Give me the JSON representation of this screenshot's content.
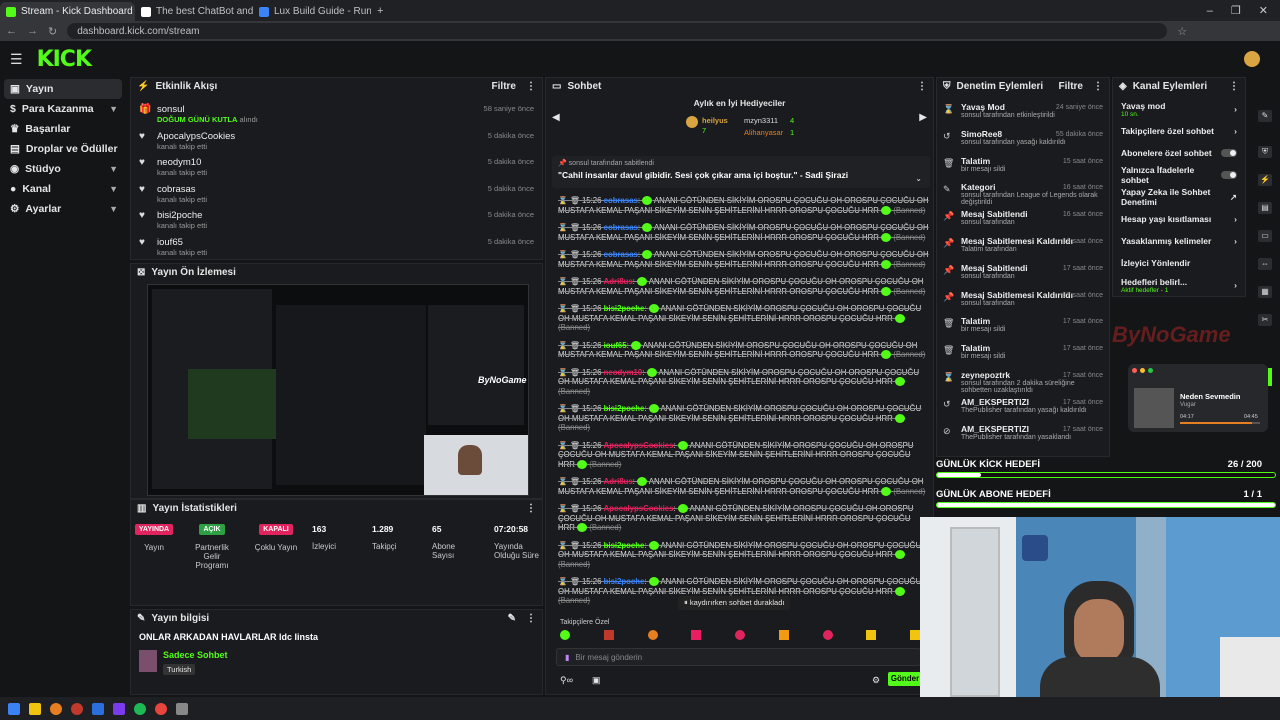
{
  "browser": {
    "tabs": [
      {
        "label": "Stream - Kick Dashboard",
        "color": "#53fc18"
      },
      {
        "label": "The best ChatBot and Widgets",
        "color": "#ffffff"
      },
      {
        "label": "Lux Build Guide - Runes, Items",
        "color": "#3b82f6"
      }
    ],
    "url": "dashboard.kick.com/stream"
  },
  "header": {
    "logo": "KICK"
  },
  "sidebar": {
    "items": [
      {
        "label": "Yayın",
        "icon": "video-icon",
        "active": true
      },
      {
        "label": "Para Kazanma",
        "icon": "money-icon",
        "chevron": true
      },
      {
        "label": "Başarılar",
        "icon": "trophy-icon"
      },
      {
        "label": "Droplar ve Ödüller",
        "icon": "gift-icon"
      },
      {
        "label": "Stüdyo",
        "icon": "studio-icon",
        "chevron": true
      },
      {
        "label": "Kanal",
        "icon": "user-icon",
        "chevron": true
      },
      {
        "label": "Ayarlar",
        "icon": "gear-icon",
        "chevron": true
      }
    ]
  },
  "activity": {
    "title": "Etkinlik Akışı",
    "filter": "Filtre",
    "items": [
      {
        "name": "sonsul",
        "sub": "DOĞUM GÜNÜ KUTLA",
        "sub2": "alındı",
        "time": "58 saniye önce",
        "icon": "gift-icon"
      },
      {
        "name": "ApocalypsCookies",
        "sub": "kanalı takip etti",
        "time": "5 dakika önce",
        "icon": "heart-icon"
      },
      {
        "name": "neodym10",
        "sub": "kanalı takip etti",
        "time": "5 dakika önce",
        "icon": "heart-icon"
      },
      {
        "name": "cobrasas",
        "sub": "kanalı takip etti",
        "time": "5 dakika önce",
        "icon": "heart-icon"
      },
      {
        "name": "bisi2poche",
        "sub": "kanalı takip etti",
        "time": "5 dakika önce",
        "icon": "heart-icon"
      },
      {
        "name": "iouf65",
        "sub": "kanalı takip etti",
        "time": "5 dakika önce",
        "icon": "heart-icon"
      }
    ]
  },
  "preview": {
    "title": "Yayın Ön İzlemesi",
    "watermark": "ByNoGame"
  },
  "stats": {
    "title": "Yayın İstatistikleri",
    "items": [
      {
        "badge": "YAYINDA",
        "badge_color": "#e0245e",
        "label": "Yayın"
      },
      {
        "badge": "AÇIK",
        "badge_color": "#2ea043",
        "label": "Partnerlik Gelir Programı"
      },
      {
        "badge": "KAPALI",
        "badge_color": "#e0245e",
        "label": "Çoklu Yayın"
      },
      {
        "value": "163",
        "label": "İzleyici"
      },
      {
        "value": "1.289",
        "label": "Takipçi"
      },
      {
        "value": "65",
        "label": "Abone Sayısı"
      },
      {
        "value": "07:20:58",
        "label": "Yayında Olduğu Süre"
      }
    ]
  },
  "stream_info": {
    "title": "Yayın bilgisi",
    "stream_title": "ONLAR ARKADAN HAVLARLAR ldc linsta",
    "category": "Sadece Sohbet",
    "language": "Turkish"
  },
  "chat": {
    "title": "Sohbet",
    "gifters_title": "Aylık en İyi Hediyeciler",
    "gifters": [
      {
        "name": "heilyus",
        "count": "7"
      },
      {
        "name": "mzyn3311",
        "count": "4"
      },
      {
        "name": "Alihanyasar",
        "count": "1"
      }
    ],
    "pinned_by": "sonsul tarafından sabitlendi",
    "pinned_text": "\"Cahil insanlar davul gibidir. Sesi çok çıkar ama içi boştur.\" - Sadi Şirazi",
    "messages": [
      {
        "time": "15:26",
        "user": "cobrasas",
        "color": "#3b82f6",
        "text": "ANANI GÖTÜNDEN SİKİYİM OROSPU ÇOCUĞU OH OROSPU ÇOCUĞU OH MUSTAFA KEMAL PAŞANI SİKEYİM SENİN ŞEHİTLERİNİ HRRR OROSPU ÇOCUĞU HRR",
        "tag": "(Banned)"
      },
      {
        "time": "15:26",
        "user": "cobrasas",
        "color": "#3b82f6",
        "text": "ANANI GÖTÜNDEN SİKİYİM OROSPU ÇOCUĞU OH OROSPU ÇOCUĞU OH MUSTAFA KEMAL PAŞANI SİKEYİM SENİN ŞEHİTLERİNİ HRRR OROSPU ÇOCUĞU HRR",
        "tag": "(Banned)"
      },
      {
        "time": "15:26",
        "user": "cobrasas",
        "color": "#3b82f6",
        "text": "ANANI GÖTÜNDEN SİKİYİM OROSPU ÇOCUĞU OH OROSPU ÇOCUĞU OH MUSTAFA KEMAL PAŞANI SİKEYİM SENİN ŞEHİTLERİNİ HRRR OROSPU ÇOCUĞU HRR",
        "tag": "(Banned)"
      },
      {
        "time": "15:26",
        "user": "Adri8us",
        "color": "#e0245e",
        "text": "ANANI GÖTÜNDEN SİKİYİM OROSPU ÇOCUĞU OH OROSPU ÇOCUĞU OH MUSTAFA KEMAL PAŞANI SİKEYİM SENİN ŞEHİTLERİNİ HRRR OROSPU ÇOCUĞU HRR",
        "tag": "(Banned)"
      },
      {
        "time": "15:26",
        "user": "bisi2poche",
        "color": "#53fc18",
        "text": "ANANI GÖTÜNDEN SİKİYİM OROSPU ÇOCUĞU OH OROSPU ÇOCUĞU OH MUSTAFA KEMAL PAŞANI SİKEYİM SENİN ŞEHİTLERİNİ HRRR OROSPU ÇOCUĞU HRR",
        "tag": "(Banned)"
      },
      {
        "time": "15:26",
        "user": "iouf65",
        "color": "#53fc18",
        "text": "ANANI GÖTÜNDEN SİKİYİM OROSPU ÇOCUĞU OH OROSPU ÇOCUĞU OH MUSTAFA KEMAL PAŞANI SİKEYİM SENİN ŞEHİTLERİNİ HRRR OROSPU ÇOCUĞU HRR",
        "tag": "(Banned)"
      },
      {
        "time": "15:26",
        "user": "neodym10",
        "color": "#e0245e",
        "text": "ANANI GÖTÜNDEN SİKİYİM OROSPU ÇOCUĞU OH OROSPU ÇOCUĞU OH MUSTAFA KEMAL PAŞANI SİKEYİM SENİN ŞEHİTLERİNİ HRRR OROSPU ÇOCUĞU HRR",
        "tag": "(Banned)"
      },
      {
        "time": "15:26",
        "user": "bisi2poche",
        "color": "#53fc18",
        "text": "ANANI GÖTÜNDEN SİKİYİM OROSPU ÇOCUĞU OH OROSPU ÇOCUĞU OH MUSTAFA KEMAL PAŞANI SİKEYİM SENİN ŞEHİTLERİNİ HRRR OROSPU ÇOCUĞU HRR",
        "tag": "(Banned)"
      },
      {
        "time": "15:26",
        "user": "ApocalypsCookies",
        "color": "#e0245e",
        "text": "ANANI GÖTÜNDEN SİKİYİM OROSPU ÇOCUĞU OH OROSPU ÇOCUĞU OH MUSTAFA KEMAL PAŞANI SİKEYİM SENİN ŞEHİTLERİNİ HRRR OROSPU ÇOCUĞU HRR",
        "tag": "(Banned)"
      },
      {
        "time": "15:26",
        "user": "Adri8us",
        "color": "#e0245e",
        "text": "ANANI GÖTÜNDEN SİKİYİM OROSPU ÇOCUĞU OH OROSPU ÇOCUĞU OH MUSTAFA KEMAL PAŞANI SİKEYİM SENİN ŞEHİTLERİNİ HRRR OROSPU ÇOCUĞU HRR",
        "tag": "(Banned)"
      },
      {
        "time": "15:26",
        "user": "ApocalypsCookies",
        "color": "#e0245e",
        "text": "ANANI GÖTÜNDEN SİKİYİM OROSPU ÇOCUĞU OH OROSPU ÇOCUĞU OH MUSTAFA KEMAL PAŞANI SİKEYİM SENİN ŞEHİTLERİNİ HRRR OROSPU ÇOCUĞU HRR",
        "tag": "(Banned)"
      },
      {
        "time": "15:26",
        "user": "bisi2poche",
        "color": "#53fc18",
        "text": "ANANI GÖTÜNDEN SİKİYİM OROSPU ÇOCUĞU OH OROSPU ÇOCUĞU OH MUSTAFA KEMAL PAŞANI SİKEYİM SENİN ŞEHİTLERİNİ HRRR OROSPU ÇOCUĞU HRR",
        "tag": "(Banned)"
      },
      {
        "time": "15:26",
        "user": "bisi2poche",
        "color": "#3b82f6",
        "text": "ANANI GÖTÜNDEN SİKİYİM OROSPU ÇOCUĞU OH OROSPU ÇOCUĞU OH MUSTAFA KEMAL PAŞANI SİKEYİM SENİN ŞEHİTLERİNİ HRRR OROSPU ÇOCUĞU HRR",
        "tag": "(Banned)"
      },
      {
        "time": "15:26",
        "user": "ApocalypsCookies",
        "color": "#e0245e",
        "text": "ANANI GÖTÜNDEN SİKİYİM OROSPU ÇOCUĞU OH OROSPU ÇOCUĞU OH MUSTAFA KEMAL PAŞANI SİKEYİM SENİN ŞEHİTLERİNİ HRRR OROSPU ÇOCUĞU HRR",
        "tag": "(Banned)"
      },
      {
        "time": "15:26",
        "user": "iouf65",
        "color": "#53fc18",
        "text": "ANANI GÖTÜNDEN SİKİYİM OROSPU ÇOCUĞU OH OROSPU ÇOCUĞU OH MUSTAFA KEMAL PAŞANI SİKEYİM SENİN ŞEHİTLERİNİ HRRR OROSPU ÇOCUĞU HRR",
        "tag": "(Banned)"
      }
    ],
    "paused": "kaydırırken sohbet durakladı",
    "emote_label": "Takipçilere Özel",
    "input_placeholder": "Bir mesaj gönderin",
    "send": "Gönder"
  },
  "moderation": {
    "title": "Denetim Eylemleri",
    "filter": "Filtre",
    "items": [
      {
        "name": "Yavaş Mod",
        "sub": "sonsul tarafından etkinleştirildi",
        "time": "24 saniye önce",
        "icon": "slow-icon"
      },
      {
        "name": "SimoRee8",
        "sub": "sonsul tarafından yasağı kaldırıldı",
        "time": "55 dakika önce",
        "icon": "unban-icon"
      },
      {
        "name": "Talatim",
        "sub": "bir mesajı sildi",
        "time": "15 saat önce",
        "icon": "trash-icon"
      },
      {
        "name": "Kategori",
        "sub": "sonsul tarafından League of Legends olarak değiştirildi",
        "time": "16 saat önce",
        "icon": "edit-icon"
      },
      {
        "name": "Mesaj Sabitlendi",
        "sub": "sonsul tarafından",
        "time": "16 saat önce",
        "icon": "pin-icon"
      },
      {
        "name": "Mesaj Sabitlemesi Kaldırıldı",
        "sub": "Talatim tarafından",
        "time": "16 saat önce",
        "icon": "pin-icon"
      },
      {
        "name": "Mesaj Sabitlendi",
        "sub": "sonsul tarafından",
        "time": "17 saat önce",
        "icon": "pin-icon"
      },
      {
        "name": "Mesaj Sabitlemesi Kaldırıldı",
        "sub": "sonsul tarafından",
        "time": "17 saat önce",
        "icon": "pin-icon"
      },
      {
        "name": "Talatim",
        "sub": "bir mesajı sildi",
        "time": "17 saat önce",
        "icon": "trash-icon"
      },
      {
        "name": "Talatim",
        "sub": "bir mesajı sildi",
        "time": "17 saat önce",
        "icon": "trash-icon"
      },
      {
        "name": "zeynepoztrk",
        "sub": "sonsul tarafından 2 dakika süreliğine sohbetten uzaklaştırıldı",
        "time": "17 saat önce",
        "icon": "timeout-icon"
      },
      {
        "name": "AM_EKSPERTIZI",
        "sub": "ThePublisher tarafından yasağı kaldırıldı",
        "time": "17 saat önce",
        "icon": "unban-icon"
      },
      {
        "name": "AM_EKSPERTIZI",
        "sub": "ThePublisher tarafından yasaklandı",
        "time": "17 saat önce",
        "icon": "ban-icon"
      }
    ]
  },
  "channel_actions": {
    "title": "Kanal Eylemleri",
    "items": [
      {
        "label": "Yavaş mod",
        "sub": "10 sn.",
        "control": "arrow"
      },
      {
        "label": "Takipçilere özel sohbet",
        "control": "arrow"
      },
      {
        "label": "Abonelere özel sohbet",
        "control": "toggle"
      },
      {
        "label": "Yalnızca İfadelerle sohbet",
        "control": "toggle"
      },
      {
        "label": "Yapay Zeka ile Sohbet Denetimi",
        "control": "external"
      },
      {
        "label": "Hesap yaşı kısıtlaması",
        "control": "arrow"
      },
      {
        "label": "Yasaklanmış kelimeler",
        "control": "arrow"
      },
      {
        "label": "İzleyici Yönlendir",
        "control": "none"
      },
      {
        "label": "Hedefleri belirl...",
        "sub": "Aktif hedefler - 1",
        "control": "arrow"
      }
    ]
  },
  "overlay": {
    "brand": "ByNoGame",
    "song_title": "Neden Sevmedin",
    "song_artist": "Vugar",
    "song_elapsed": "04:17",
    "song_total": "04:45",
    "song_progress": 0.9
  },
  "goals": [
    {
      "title": "GÜNLÜK KİCK HEDEFİ",
      "count": "26 / 200",
      "progress": 0.13
    },
    {
      "title": "GÜNLÜK ABONE HEDEFİ",
      "count": "1 / 1",
      "progress": 1.0
    }
  ],
  "colors": {
    "accent": "#53fc18",
    "live": "#e0245e",
    "panel": "#191b1f"
  }
}
